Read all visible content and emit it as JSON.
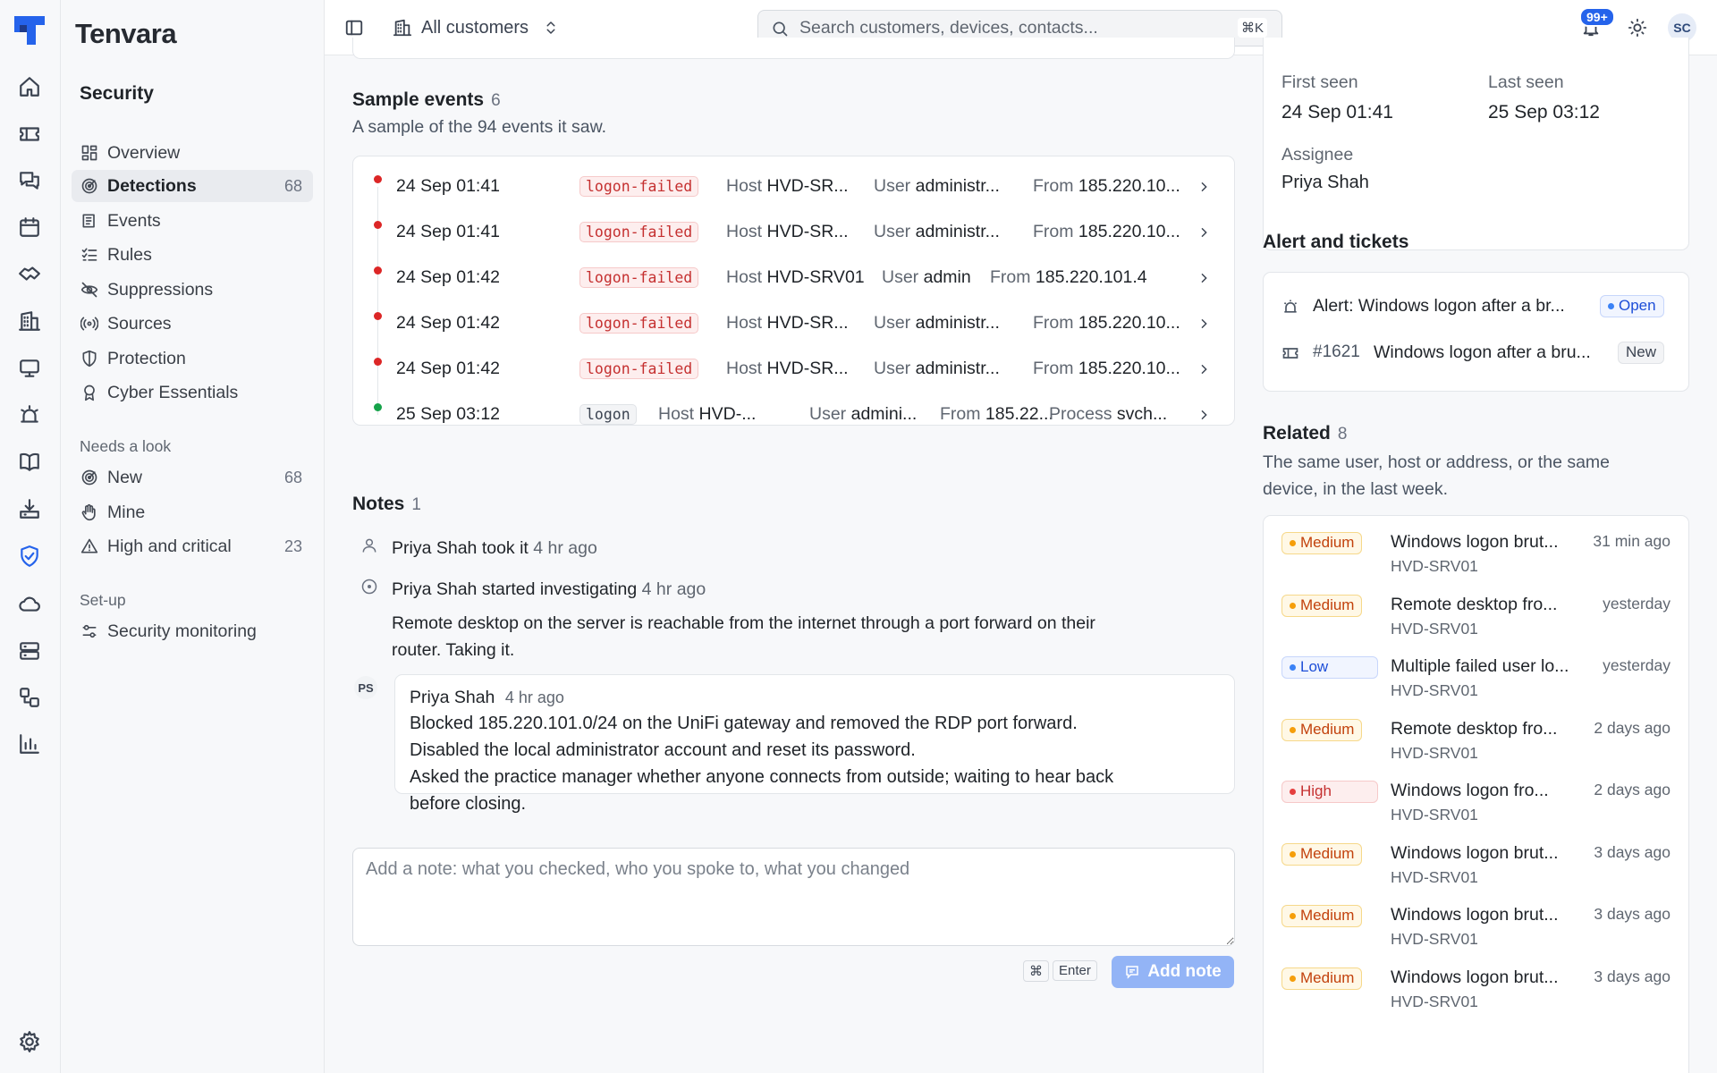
{
  "brand": "Tenvara",
  "sidebar": {
    "section": "Security",
    "items": [
      {
        "label": "Overview",
        "icon": "overview-icon"
      },
      {
        "label": "Detections",
        "icon": "radar-icon",
        "count": "68"
      },
      {
        "label": "Events",
        "icon": "events-icon"
      },
      {
        "label": "Rules",
        "icon": "rules-icon"
      },
      {
        "label": "Suppressions",
        "icon": "eye-off-icon"
      },
      {
        "label": "Sources",
        "icon": "broadcast-icon"
      },
      {
        "label": "Protection",
        "icon": "shield-icon"
      },
      {
        "label": "Cyber Essentials",
        "icon": "badge-icon"
      }
    ],
    "group_needs": "Needs a look",
    "needs_items": [
      {
        "label": "New",
        "icon": "radar-icon",
        "count": "68"
      },
      {
        "label": "Mine",
        "icon": "hand-icon"
      },
      {
        "label": "High and critical",
        "icon": "warning-icon",
        "count": "23"
      }
    ],
    "group_setup": "Set-up",
    "setup_items": [
      {
        "label": "Security monitoring",
        "icon": "sliders-icon"
      }
    ]
  },
  "topbar": {
    "customer": "All customers",
    "search_placeholder": "Search customers, devices, contacts...",
    "search_shortcut": "⌘K",
    "notif_badge": "99+",
    "avatar": "SC"
  },
  "sample_events": {
    "title": "Sample events",
    "count": "6",
    "subtitle": "A sample of the 94 events it saw.",
    "rows": [
      {
        "time": "24 Sep 01:41",
        "tag": "logon-failed",
        "status": "red",
        "host": "HVD-SR...",
        "user": "administr...",
        "from": "185.220.10..."
      },
      {
        "time": "24 Sep 01:41",
        "tag": "logon-failed",
        "status": "red",
        "host": "HVD-SR...",
        "user": "administr...",
        "from": "185.220.10..."
      },
      {
        "time": "24 Sep 01:42",
        "tag": "logon-failed",
        "status": "red",
        "host": "HVD-SRV01",
        "user": "admin",
        "from": "185.220.101.4"
      },
      {
        "time": "24 Sep 01:42",
        "tag": "logon-failed",
        "status": "red",
        "host": "HVD-SR...",
        "user": "administr...",
        "from": "185.220.10..."
      },
      {
        "time": "24 Sep 01:42",
        "tag": "logon-failed",
        "status": "red",
        "host": "HVD-SR...",
        "user": "administr...",
        "from": "185.220.10..."
      },
      {
        "time": "25 Sep 03:12",
        "tag": "logon",
        "status": "green",
        "host": "HVD-...",
        "user": "admini...",
        "from": "185.22...",
        "process": "svch..."
      }
    ],
    "labels": {
      "host": "Host",
      "user": "User",
      "from": "From",
      "process": "Process"
    }
  },
  "notes": {
    "title": "Notes",
    "count": "1",
    "took_name": "Priya Shah",
    "took_text": "took it",
    "took_time": "4 hr ago",
    "inv_name": "Priya Shah",
    "inv_text": "started investigating",
    "inv_time": "4 hr ago",
    "inv_body_1": "Remote desktop on the server is reachable from the internet through a port forward on their",
    "inv_body_2": "router. Taking it.",
    "note_initials": "PS",
    "note_author": "Priya Shah",
    "note_time": "4 hr ago",
    "note_lines": [
      "Blocked 185.220.101.0/24 on the UniFi gateway and removed the RDP port forward.",
      "Disabled the local administrator account and reset its password.",
      "Asked the practice manager whether anyone connects from outside; waiting to hear back",
      "before closing."
    ],
    "placeholder": "Add a note: what you checked, who you spoke to, what you changed",
    "kbd_cmd": "⌘",
    "kbd_enter": "Enter",
    "add_label": "Add note"
  },
  "details": {
    "first_seen_label": "First seen",
    "first_seen": "24 Sep 01:41",
    "last_seen_label": "Last seen",
    "last_seen": "25 Sep 03:12",
    "assignee_label": "Assignee",
    "assignee": "Priya Shah"
  },
  "alerts": {
    "title": "Alert and tickets",
    "alert_text": "Alert: Windows logon after a br...",
    "alert_status": "Open",
    "ticket_id": "#1621",
    "ticket_text": "Windows logon after a bru...",
    "ticket_status": "New"
  },
  "related": {
    "title": "Related",
    "count": "8",
    "subtitle_1": "The same user, host or address, or the same",
    "subtitle_2": "device, in the last week.",
    "items": [
      {
        "sev": "Medium",
        "title": "Windows logon brut...",
        "host": "HVD-SRV01",
        "when": "31 min ago"
      },
      {
        "sev": "Medium",
        "title": "Remote desktop fro...",
        "host": "HVD-SRV01",
        "when": "yesterday"
      },
      {
        "sev": "Low",
        "title": "Multiple failed user lo...",
        "host": "HVD-SRV01",
        "when": "yesterday"
      },
      {
        "sev": "Medium",
        "title": "Remote desktop fro...",
        "host": "HVD-SRV01",
        "when": "2 days ago"
      },
      {
        "sev": "High",
        "title": "Windows logon fro...",
        "host": "HVD-SRV01",
        "when": "2 days ago"
      },
      {
        "sev": "Medium",
        "title": "Windows logon brut...",
        "host": "HVD-SRV01",
        "when": "3 days ago"
      },
      {
        "sev": "Medium",
        "title": "Windows logon brut...",
        "host": "HVD-SRV01",
        "when": "3 days ago"
      },
      {
        "sev": "Medium",
        "title": "Windows logon brut...",
        "host": "HVD-SRV01",
        "when": "3 days ago"
      }
    ]
  }
}
